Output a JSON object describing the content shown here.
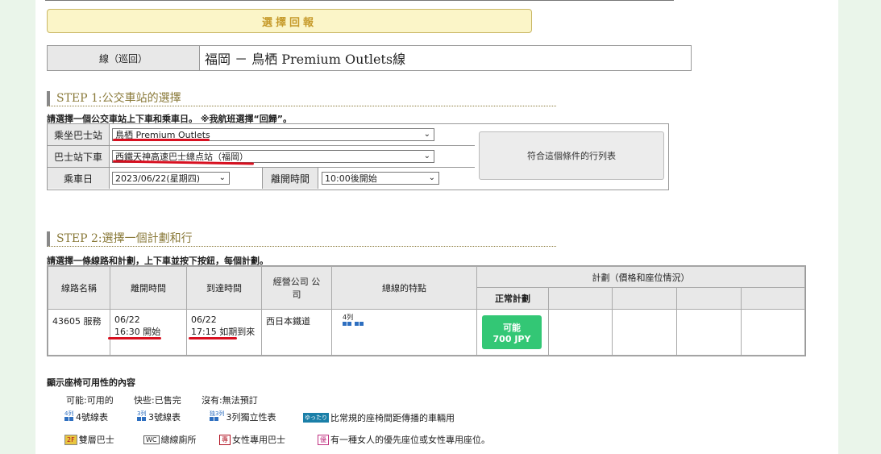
{
  "return_button": "選擇回報",
  "route": {
    "label": "線（巡回）",
    "name": "福岡 － 鳥栖 Premium Outlets線"
  },
  "step1": {
    "title": "STEP 1:公交車站的選擇",
    "desc": "請選擇一個公交車站上下車和乘車日。 ※我航班選擇“回歸”。",
    "boarding_label": "乘坐巴士站",
    "boarding_value": "鳥栖 Premium Outlets",
    "alight_label": "巴士站下車",
    "alight_value": "西鐵天神高速巴士總点站（福岡）",
    "date_label": "乘車日",
    "date_value": "2023/06/22(星期四)",
    "depart_label": "離開時間",
    "depart_value": "10:00後開始",
    "search_button": "符合這個條件的行列表"
  },
  "step2": {
    "title": "STEP 2:選擇一個計劃和行",
    "desc": "請選擇一條線路和計劃，上下車並按下按鈕，每個計劃。",
    "headers": {
      "route": "線路名稱",
      "depart": "離開時間",
      "arrive": "到達時間",
      "company": "經營公司 公司",
      "features": "總線的特點",
      "plan": "計劃（價格和座位情況）",
      "normal_plan": "正常計劃"
    },
    "row": {
      "route": "43605 服務",
      "depart_date": "06/22",
      "depart_time": "16:30 開始",
      "arrive_date": "06/22",
      "arrive_time": "17:15 如期到來",
      "company": "西日本鐵道",
      "feature_badge": "4列",
      "plan_status": "可能",
      "plan_price": "700 JPY"
    }
  },
  "legend": {
    "title": "顯示座椅可用性的內容",
    "status": [
      "可能:可用的",
      "快些:已售完",
      "沒有:無法預訂"
    ],
    "icons": [
      {
        "badge": "4列",
        "text": "4號線表"
      },
      {
        "badge": "3列",
        "text": "3號線表"
      },
      {
        "badge": "独3列",
        "text": "3列獨立性表"
      },
      {
        "badge": "ゆったり",
        "text": "比常規的座椅間距傳播的車輛用"
      },
      {
        "badge": "2F",
        "text": "雙層巴士"
      },
      {
        "badge": "WC",
        "text": "總線廁所"
      },
      {
        "badge": "專",
        "text": "女性專用巴士"
      },
      {
        "badge": "優",
        "text": "有一種女人的優先座位或女性專用座位。"
      }
    ]
  },
  "colors": {
    "available": "#33c775",
    "underline": "#d81020",
    "step_title": "#8a7a3a"
  }
}
